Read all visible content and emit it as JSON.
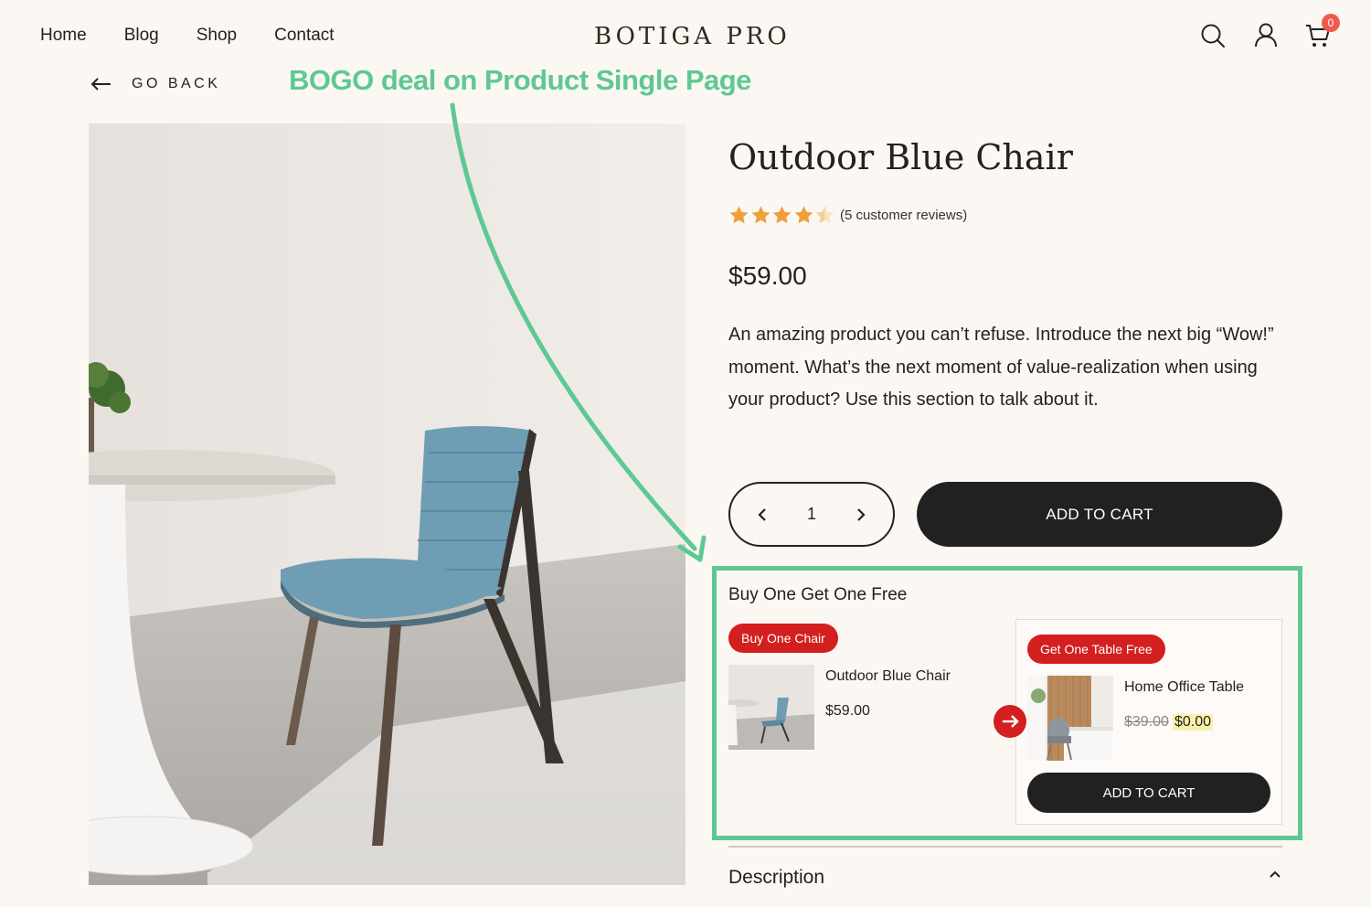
{
  "header": {
    "nav": [
      "Home",
      "Blog",
      "Shop",
      "Contact"
    ],
    "brand": "BOTIGA PRO",
    "icons": [
      "search-icon",
      "user-icon",
      "cart-icon"
    ],
    "cart_count": "0"
  },
  "back": {
    "label": "GO BACK"
  },
  "annotation": {
    "text": "BOGO deal on Product Single Page"
  },
  "product": {
    "title": "Outdoor Blue Chair",
    "rating": 4.5,
    "reviews": "(5 customer reviews)",
    "price": "$59.00",
    "description": "An amazing product you can’t refuse. Introduce the next big “Wow!” moment. What’s the next moment of value-realization when using your product? Use this section to talk about it.",
    "quantity": "1",
    "add_to_cart": "ADD TO CART"
  },
  "bogo": {
    "title": "Buy One Get One Free",
    "buy": {
      "badge": "Buy One Chair",
      "name": "Outdoor Blue Chair",
      "price": "$59.00"
    },
    "get": {
      "badge": "Get One Table Free",
      "name": "Home Office Table",
      "old_price": "$39.00",
      "new_price": "$0.00",
      "button": "ADD TO CART"
    }
  },
  "tabs": {
    "description": "Description"
  },
  "colors": {
    "accent_green": "#5ec893",
    "badge_red": "#d31f1f",
    "button_dark": "#212121"
  }
}
